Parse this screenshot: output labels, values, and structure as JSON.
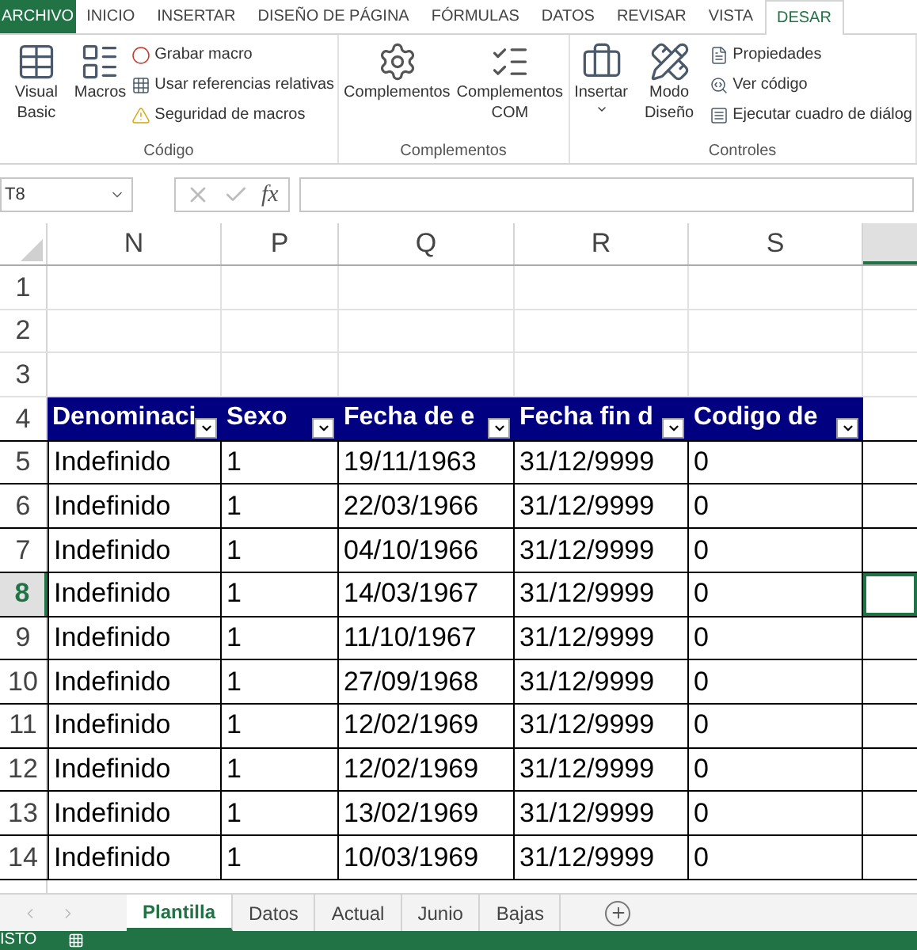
{
  "menu_tabs": [
    {
      "label": "ARCHIVO",
      "selected": false,
      "kind": "file"
    },
    {
      "label": "INICIO",
      "selected": false,
      "kind": "tab"
    },
    {
      "label": "INSERTAR",
      "selected": false,
      "kind": "tab"
    },
    {
      "label": "DISEÑO DE PÁGINA",
      "selected": false,
      "kind": "tab"
    },
    {
      "label": "FÓRMULAS",
      "selected": false,
      "kind": "tab"
    },
    {
      "label": "DATOS",
      "selected": false,
      "kind": "tab"
    },
    {
      "label": "REVISAR",
      "selected": false,
      "kind": "tab"
    },
    {
      "label": "VISTA",
      "selected": false,
      "kind": "tab"
    },
    {
      "label": "DESAR",
      "selected": true,
      "kind": "tab"
    }
  ],
  "ribbon": {
    "groups": [
      {
        "label": "Código",
        "large": [
          {
            "label": "Visual Basic"
          },
          {
            "label": "Macros"
          }
        ],
        "small": [
          {
            "label": "Grabar macro"
          },
          {
            "label": "Usar referencias relativas"
          },
          {
            "label": "Seguridad de macros"
          }
        ]
      },
      {
        "label": "Complementos",
        "large": [
          {
            "label": "Complementos"
          },
          {
            "label": "Complementos COM"
          }
        ]
      },
      {
        "label": "Controles",
        "large": [
          {
            "label": "Insertar"
          },
          {
            "label": "Modo Diseño"
          }
        ],
        "small": [
          {
            "label": "Propiedades"
          },
          {
            "label": "Ver código"
          },
          {
            "label": "Ejecutar cuadro de diálog"
          }
        ]
      }
    ]
  },
  "name_box": {
    "value": "T8"
  },
  "formula_bar": {
    "fx": "fx"
  },
  "sheet": {
    "columns": [
      "N",
      "P",
      "Q",
      "R",
      "S"
    ],
    "rows": [
      {
        "number": "1",
        "selected": false,
        "kind": "empty",
        "cells": []
      },
      {
        "number": "2",
        "selected": false,
        "kind": "empty",
        "cells": []
      },
      {
        "number": "3",
        "selected": false,
        "kind": "empty",
        "cells": []
      },
      {
        "number": "4",
        "selected": false,
        "kind": "header",
        "cells": [
          "Denominaci",
          "Sexo",
          "Fecha de e",
          "Fecha fin d",
          "Codigo de"
        ]
      },
      {
        "number": "5",
        "selected": false,
        "kind": "data",
        "cells": [
          "Indefinido",
          "1",
          "19/11/1963",
          "31/12/9999",
          "0"
        ]
      },
      {
        "number": "6",
        "selected": false,
        "kind": "data",
        "cells": [
          "Indefinido",
          "1",
          "22/03/1966",
          "31/12/9999",
          "0"
        ]
      },
      {
        "number": "7",
        "selected": false,
        "kind": "data",
        "cells": [
          "Indefinido",
          "1",
          "04/10/1966",
          "31/12/9999",
          "0"
        ]
      },
      {
        "number": "8",
        "selected": true,
        "kind": "data",
        "cells": [
          "Indefinido",
          "1",
          "14/03/1967",
          "31/12/9999",
          "0"
        ]
      },
      {
        "number": "9",
        "selected": false,
        "kind": "data",
        "cells": [
          "Indefinido",
          "1",
          "11/10/1967",
          "31/12/9999",
          "0"
        ]
      },
      {
        "number": "10",
        "selected": false,
        "kind": "data",
        "cells": [
          "Indefinido",
          "1",
          "27/09/1968",
          "31/12/9999",
          "0"
        ]
      },
      {
        "number": "11",
        "selected": false,
        "kind": "data",
        "cells": [
          "Indefinido",
          "1",
          "12/02/1969",
          "31/12/9999",
          "0"
        ]
      },
      {
        "number": "12",
        "selected": false,
        "kind": "data",
        "cells": [
          "Indefinido",
          "1",
          "12/02/1969",
          "31/12/9999",
          "0"
        ]
      },
      {
        "number": "13",
        "selected": false,
        "kind": "data",
        "cells": [
          "Indefinido",
          "1",
          "13/02/1969",
          "31/12/9999",
          "0"
        ]
      },
      {
        "number": "14",
        "selected": false,
        "kind": "data",
        "cells": [
          "Indefinido",
          "1",
          "10/03/1969",
          "31/12/9999",
          "0"
        ]
      }
    ]
  },
  "sheet_tabs": [
    {
      "label": "Plantilla",
      "selected": true
    },
    {
      "label": "Datos",
      "selected": false
    },
    {
      "label": "Actual",
      "selected": false
    },
    {
      "label": "Junio",
      "selected": false
    },
    {
      "label": "Bajas",
      "selected": false
    }
  ],
  "status_bar": {
    "text": "ISTO"
  }
}
